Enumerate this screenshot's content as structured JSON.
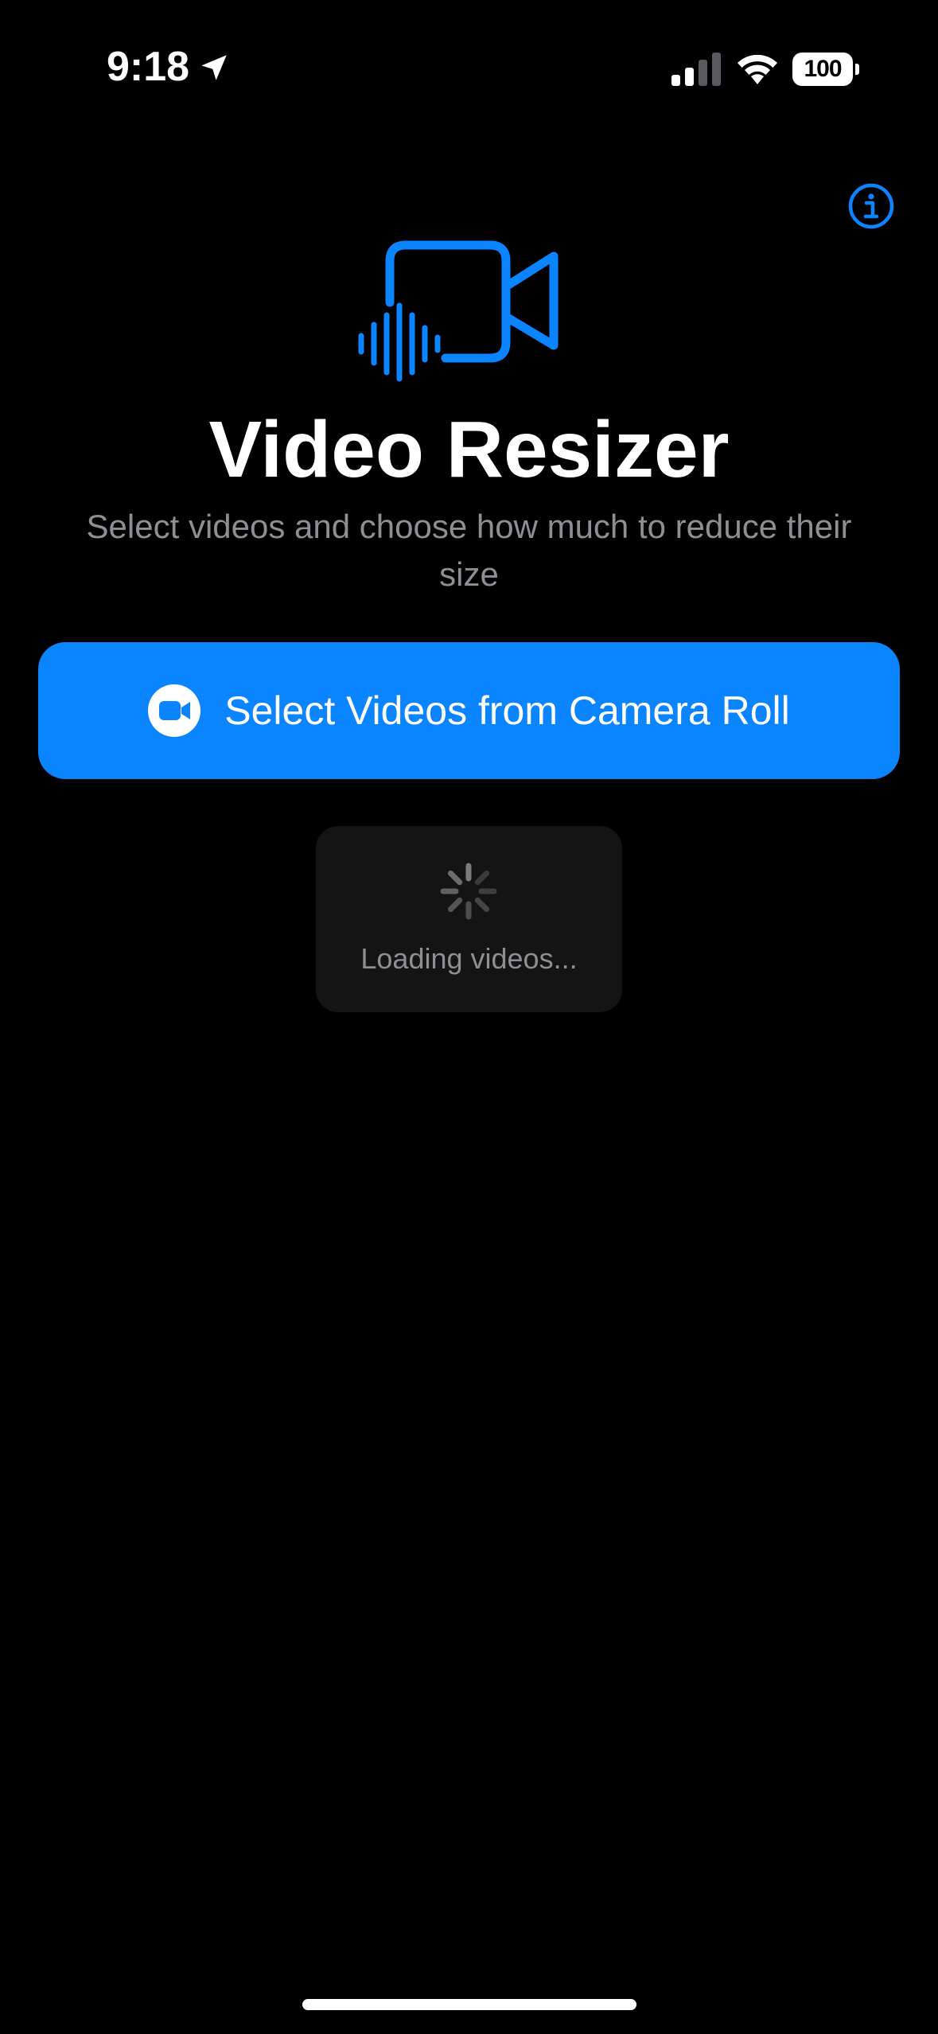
{
  "status_bar": {
    "time": "9:18",
    "battery_level": "100",
    "location_icon": "location-arrow-icon",
    "signal_icon": "cellular-signal-icon",
    "wifi_icon": "wifi-icon"
  },
  "header": {
    "info_icon": "info-circle-icon"
  },
  "hero": {
    "icon": "video-camera-waveform-icon",
    "title": "Video Resizer",
    "subtitle": "Select videos and choose how much to reduce their size"
  },
  "select_button": {
    "icon": "video-camera-circle-icon",
    "label": "Select Videos from Camera Roll"
  },
  "loading": {
    "icon": "activity-spinner-icon",
    "text": "Loading videos..."
  },
  "colors": {
    "accent": "#0A84FF",
    "background": "#000000",
    "secondary_text": "#8E8E93",
    "panel": "#141414"
  }
}
